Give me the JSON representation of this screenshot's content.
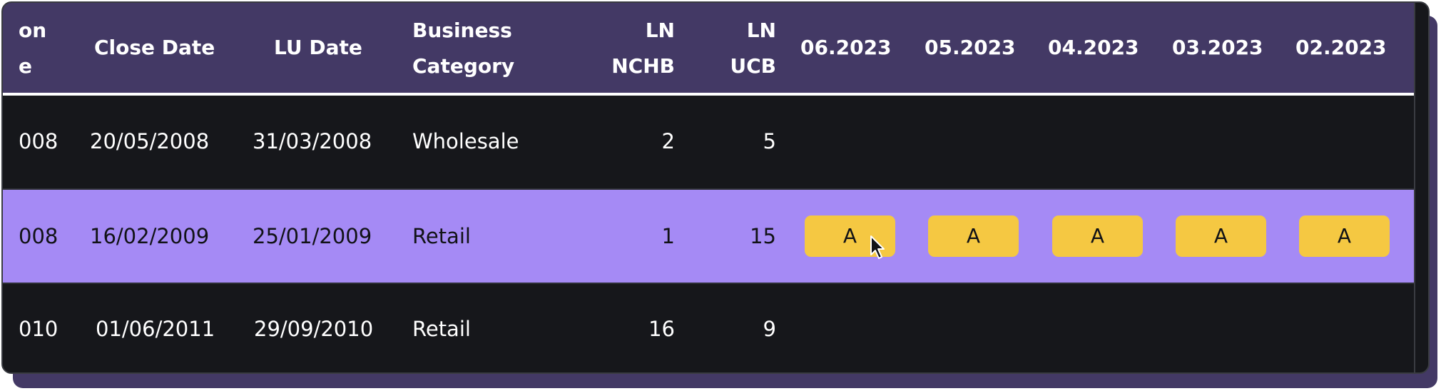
{
  "columns": {
    "partial_col_line1": "on",
    "partial_col_line2": "e",
    "close_date": "Close Date",
    "lu_date": "LU Date",
    "business_category_line1": "Business",
    "business_category_line2": "Category",
    "ln_nchb_line1": "LN",
    "ln_nchb_line2": "NCHB",
    "ln_ucb_line1": "LN",
    "ln_ucb_line2": "UCB",
    "months": [
      "06.2023",
      "05.2023",
      "04.2023",
      "03.2023",
      "02.2023"
    ]
  },
  "rows": [
    {
      "partial": "008",
      "close_date": "20/05/2008",
      "lu_date": "31/03/2008",
      "business_category": "Wholesale",
      "ln_nchb": "2",
      "ln_ucb": "5",
      "badges": [
        "",
        "",
        "",
        "",
        ""
      ],
      "highlighted": false
    },
    {
      "partial": "008",
      "close_date": "16/02/2009",
      "lu_date": "25/01/2009",
      "business_category": "Retail",
      "ln_nchb": "1",
      "ln_ucb": "15",
      "badges": [
        "A",
        "A",
        "A",
        "A",
        "A"
      ],
      "highlighted": true
    },
    {
      "partial": "010",
      "close_date": "01/06/2011",
      "lu_date": "29/09/2010",
      "business_category": "Retail",
      "ln_nchb": "16",
      "ln_ucb": "9",
      "badges": [
        "",
        "",
        "",
        "",
        ""
      ],
      "highlighted": false
    }
  ],
  "colors": {
    "header_bg": "#433965",
    "row_bg": "#16171b",
    "highlight_bg": "#a58af5",
    "badge_bg": "#f5c842",
    "text_light": "#ffffff",
    "text_dark": "#111216"
  },
  "icons": {
    "cursor": "mouse-pointer-icon"
  }
}
